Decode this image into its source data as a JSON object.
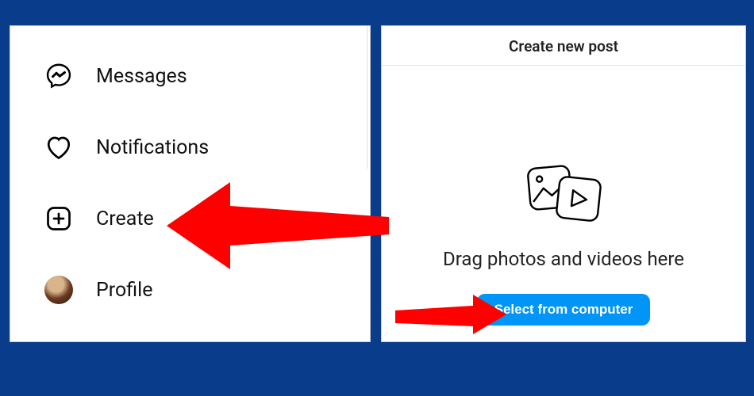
{
  "sidebar": {
    "items": [
      {
        "label": "Messages",
        "icon": "messenger-icon"
      },
      {
        "label": "Notifications",
        "icon": "heart-icon"
      },
      {
        "label": "Create",
        "icon": "create-icon"
      },
      {
        "label": "Profile",
        "icon": "avatar"
      }
    ]
  },
  "dialog": {
    "title": "Create new post",
    "drop_text": "Drag photos and videos here",
    "select_button": "Select from computer"
  },
  "colors": {
    "page_bg": "#0a3c8c",
    "accent": "#0095f6",
    "arrow": "#ff0000"
  }
}
